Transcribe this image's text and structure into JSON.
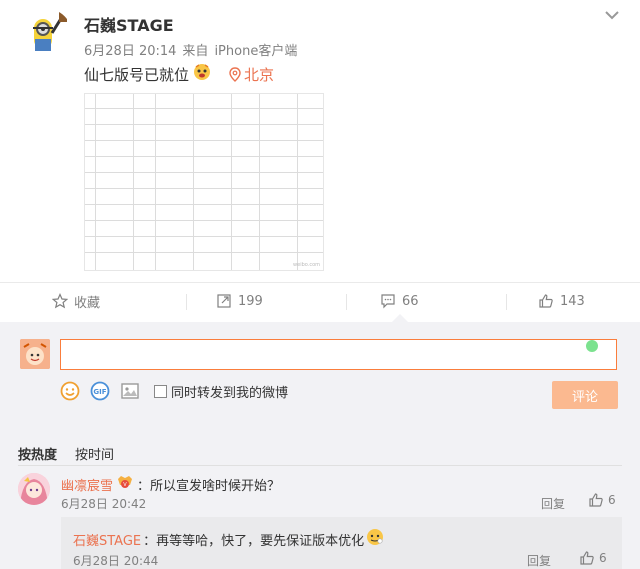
{
  "post": {
    "username": "石巍STAGE",
    "date": "6月28日 20:14",
    "source_prefix": "来自",
    "source_client": "iPhone客户端",
    "text": "仙七版号已就位",
    "location": "北京",
    "image_watermark": "weibo.com"
  },
  "actions": {
    "favorite_label": "收藏",
    "repost_count": "199",
    "comment_count": "66",
    "like_count": "143"
  },
  "composer": {
    "input_value": "",
    "repost_checkbox_label": "同时转发到我的微博",
    "submit_label": "评论"
  },
  "sort": {
    "by_heat": "按热度",
    "by_time": "按时间"
  },
  "comments": [
    {
      "user": "幽凛宸雪",
      "text": "：所以宣发啥时候开始？",
      "time": "6月28日 20:42",
      "reply_label": "回复",
      "likes": "6"
    }
  ],
  "reply": {
    "user": "石巍STAGE",
    "text": "：再等等哈，快了，要先保证版本优化",
    "time": "6月28日 20:44",
    "reply_label": "回复",
    "likes": "6"
  },
  "colors": {
    "accent": "#eb7350",
    "input_border": "#fa7d3c",
    "submit_bg": "#fbb990",
    "panel_bg": "#f2f2f5"
  }
}
